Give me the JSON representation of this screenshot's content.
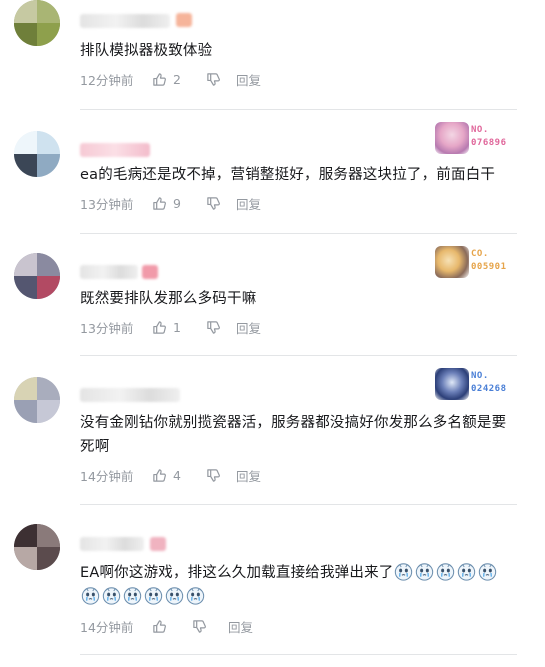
{
  "comments": [
    {
      "content": "排队模拟器极致体验",
      "time": "12分钟前",
      "likes": "2",
      "reply_label": "回复",
      "fan_badge": null
    },
    {
      "content": "ea的毛病还是改不掉，营销整挺好，服务器这块拉了，前面白干",
      "time": "13分钟前",
      "likes": "9",
      "reply_label": "回复",
      "fan_badge": {
        "line1": "NO.",
        "line2": "076896",
        "color": "#e0679b"
      }
    },
    {
      "content": "既然要排队发那么多码干嘛",
      "time": "13分钟前",
      "likes": "1",
      "reply_label": "回复",
      "fan_badge": {
        "line1": "CO.",
        "line2": "005901",
        "color": "#e6a44a"
      }
    },
    {
      "content": "没有金刚钻你就别揽瓷器活，服务器都没搞好你发那么多名额是要死啊",
      "time": "14分钟前",
      "likes": "4",
      "reply_label": "回复",
      "fan_badge": {
        "line1": "NO.",
        "line2": "024268",
        "color": "#4a7fd6"
      }
    },
    {
      "content": "EA啊你这游戏，排这么久加载直接给我弹出来了",
      "time": "14分钟前",
      "likes": "",
      "reply_label": "回复",
      "emoji_name": "crying-face-emoji",
      "emoji_count_inline": 5,
      "emoji_count_line2": 6,
      "fan_badge": null
    }
  ],
  "colors": {
    "text": "#18191c",
    "meta": "#9499a0",
    "divider": "#e3e5e7"
  }
}
